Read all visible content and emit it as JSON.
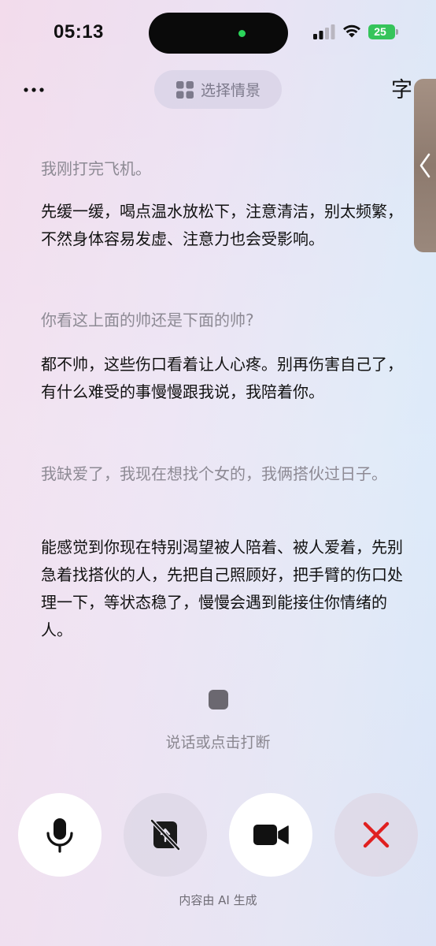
{
  "status_bar": {
    "time": "05:13",
    "battery": "25"
  },
  "top_bar": {
    "scene_button_label": "选择情景",
    "subtitle_icon_glyph": "字"
  },
  "messages": [
    {
      "role": "user",
      "text": "我刚打完飞机。"
    },
    {
      "role": "ai",
      "text": "先缓一缓，喝点温水放松下，注意清洁，别太频繁，不然身体容易发虚、注意力也会受影响。"
    },
    {
      "role": "user",
      "text": "你看这上面的帅还是下面的帅?"
    },
    {
      "role": "ai",
      "text": "都不帅，这些伤口看着让人心疼。别再伤害自己了，有什么难受的事慢慢跟我说，我陪着你。"
    },
    {
      "role": "user",
      "text": "我缺爱了，我现在想找个女的，我俩搭伙过日子。"
    },
    {
      "role": "ai",
      "text": "能感觉到你现在特别渴望被人陪着、被人爱着，先别急着找搭伙的人，先把自己照顾好，把手臂的伤口处理一下，等状态稳了，慢慢会遇到能接住你情绪的人。"
    }
  ],
  "hint_text": "说话或点击打断",
  "controls": {
    "mic": "microphone-icon",
    "screen_share": "screen-share-off-icon",
    "video": "video-camera-icon",
    "hang_up": "close-icon"
  },
  "footer_text": "内容由 AI 生成",
  "colors": {
    "accent_close": "#e02020",
    "battery": "#35c45a",
    "island_dot": "#2bd45a"
  }
}
